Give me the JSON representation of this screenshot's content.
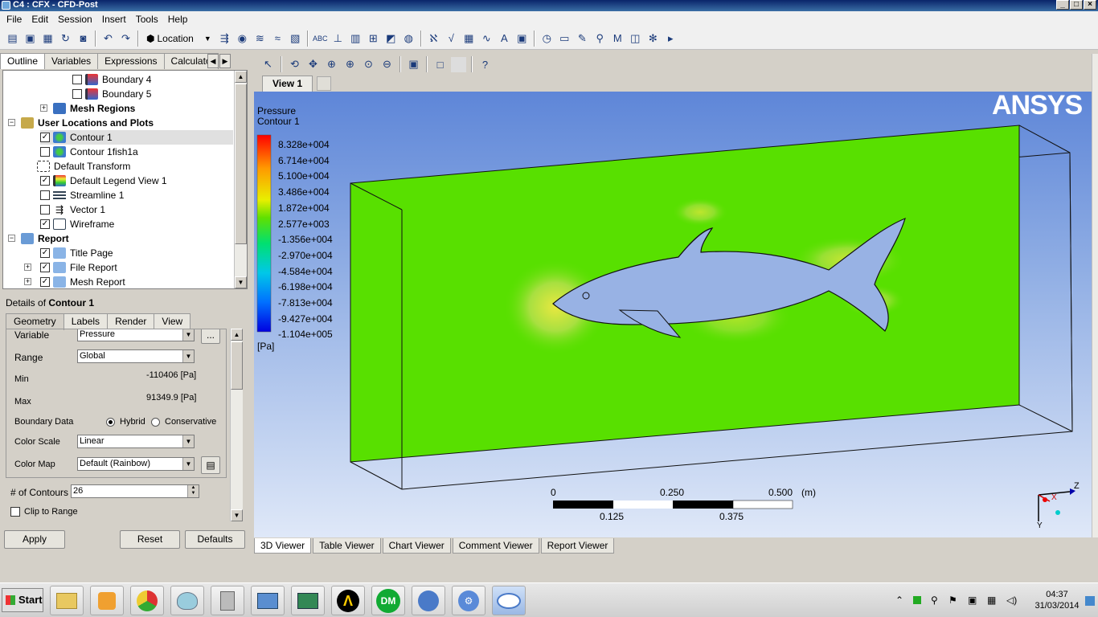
{
  "window": {
    "title": "C4 : CFX - CFD-Post"
  },
  "menu": [
    "File",
    "Edit",
    "Session",
    "Insert",
    "Tools",
    "Help"
  ],
  "toolbar": {
    "location_label": "Location"
  },
  "outline_tabs": [
    "Outline",
    "Variables",
    "Expressions",
    "Calculato"
  ],
  "tree": {
    "items": [
      {
        "label": "Boundary 4",
        "checked": false
      },
      {
        "label": "Boundary 5",
        "checked": false
      },
      {
        "label": "Mesh Regions"
      },
      {
        "label": "User Locations and Plots"
      },
      {
        "label": "Contour 1",
        "checked": true
      },
      {
        "label": "Contour 1fish1a",
        "checked": false
      },
      {
        "label": "Default Transform"
      },
      {
        "label": "Default Legend View 1",
        "checked": true
      },
      {
        "label": "Streamline 1",
        "checked": false
      },
      {
        "label": "Vector 1",
        "checked": false
      },
      {
        "label": "Wireframe",
        "checked": true
      },
      {
        "label": "Report"
      },
      {
        "label": "Title Page",
        "checked": true
      },
      {
        "label": "File Report",
        "checked": true
      },
      {
        "label": "Mesh Report",
        "checked": true
      }
    ]
  },
  "details": {
    "title_prefix": "Details of ",
    "title_object": "Contour 1",
    "tabs": [
      "Geometry",
      "Labels",
      "Render",
      "View"
    ],
    "variable_label": "Variable",
    "variable_value": "Pressure",
    "browse_label": "...",
    "range_label": "Range",
    "range_value": "Global",
    "min_label": "Min",
    "min_value": "-110406 [Pa]",
    "max_label": "Max",
    "max_value": "91349.9 [Pa]",
    "boundary_label": "Boundary Data",
    "hybrid_label": "Hybrid",
    "conservative_label": "Conservative",
    "colorscale_label": "Color Scale",
    "colorscale_value": "Linear",
    "colormap_label": "Color Map",
    "colormap_value": "Default (Rainbow)",
    "contours_label": "# of Contours",
    "contours_value": "26",
    "clip_label": "Clip to Range",
    "apply": "Apply",
    "reset": "Reset",
    "defaults": "Defaults"
  },
  "viewer": {
    "view_tab": "View 1",
    "legend_title": "Pressure",
    "legend_subtitle": "Contour 1",
    "legend_values": [
      "8.328e+004",
      "6.714e+004",
      "5.100e+004",
      "3.486e+004",
      "1.872e+004",
      "2.577e+003",
      "-1.356e+004",
      "-2.970e+004",
      "-4.584e+004",
      "-6.198e+004",
      "-7.813e+004",
      "-9.427e+004",
      "-1.104e+005"
    ],
    "legend_unit": "[Pa]",
    "logo": "ANSYS",
    "scale": {
      "top": [
        "0",
        "0.250",
        "0.500"
      ],
      "unit": "(m)",
      "bottom": [
        "0.125",
        "0.375"
      ]
    },
    "axes": {
      "z": "Z",
      "x": "X",
      "y": "Y"
    },
    "bottom_tabs": [
      "3D Viewer",
      "Table Viewer",
      "Chart Viewer",
      "Comment Viewer",
      "Report Viewer"
    ]
  },
  "taskbar": {
    "start": "Start",
    "time": "04:37",
    "date": "31/03/2014"
  }
}
